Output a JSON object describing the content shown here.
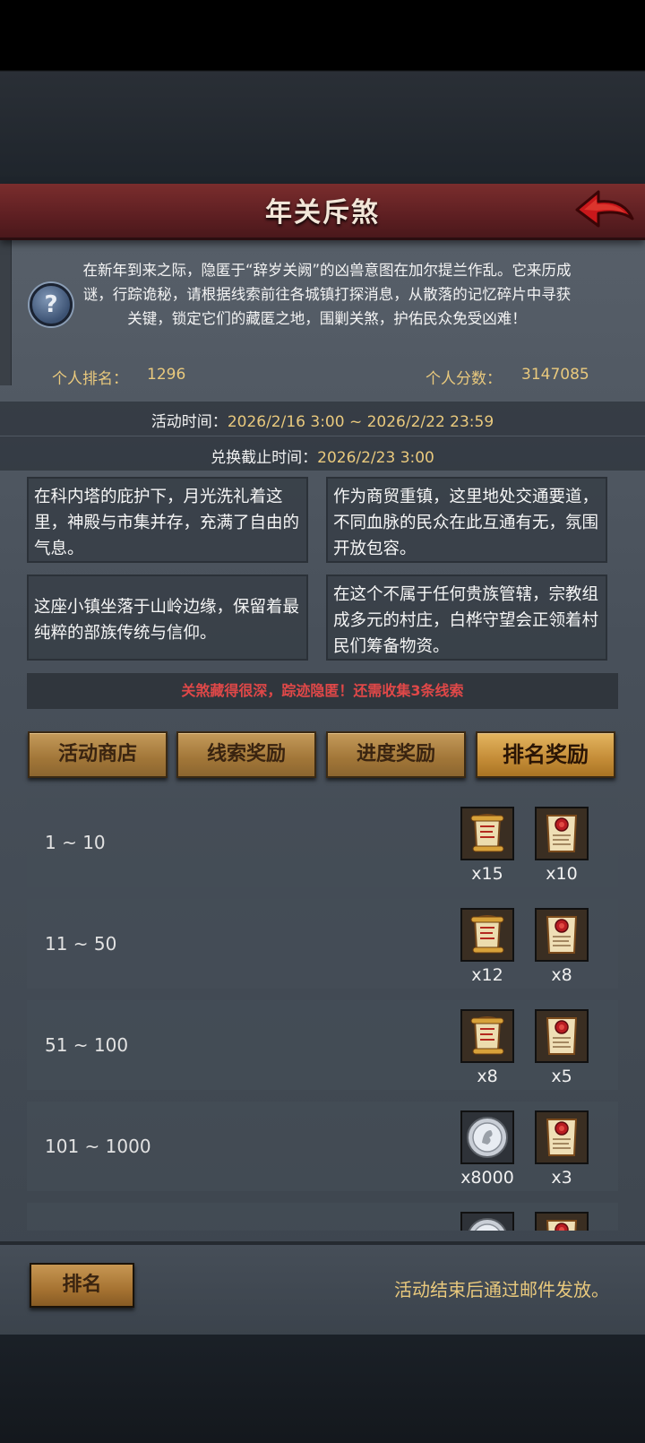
{
  "header": {
    "title": "年关斥煞"
  },
  "intro": "在新年到来之际，隐匿于“辞岁关阙”的凶兽意图在加尔提兰作乱。它来历成谜，行踪诡秘，请根据线索前往各城镇打探消息，从散落的记忆碎片中寻获关键，锁定它们的藏匿之地，围剿关煞，护佑民众免受凶难！",
  "stats": {
    "rank_label": "个人排名：",
    "rank_value": "1296",
    "score_label": "个人分数：",
    "score_value": "3147085"
  },
  "event_time": {
    "label": "活动时间：",
    "value": "2026/2/16 3:00 ~ 2026/2/22 23:59"
  },
  "exchange_deadline": {
    "label": "兑换截止时间：",
    "value": "2026/2/23 3:00"
  },
  "clues": [
    "在科内塔的庇护下，月光洗礼着这里，神殿与市集并存，充满了自由的气息。",
    "作为商贸重镇，这里地处交通要道，不同血脉的民众在此互通有无，氛围开放包容。",
    "这座小镇坐落于山岭边缘，保留着最纯粹的部族传统与信仰。",
    "在这个不属于任何贵族管辖，宗教组成多元的村庄，白桦守望会正领着村民们筹备物资。"
  ],
  "alert": "关煞藏得很深，踪迹隐匿！还需收集3条线索",
  "tabs": [
    {
      "label": "活动商店",
      "active": false
    },
    {
      "label": "线索奖励",
      "active": false
    },
    {
      "label": "进度奖励",
      "active": false
    },
    {
      "label": "排名奖励",
      "active": true
    }
  ],
  "rewards": [
    {
      "range": "1 ~ 10",
      "items": [
        {
          "icon": "scroll-gold-icon",
          "count": "x15"
        },
        {
          "icon": "scroll-seal-icon",
          "count": "x10"
        }
      ]
    },
    {
      "range": "11 ~ 50",
      "items": [
        {
          "icon": "scroll-gold-icon",
          "count": "x12"
        },
        {
          "icon": "scroll-seal-icon",
          "count": "x8"
        }
      ]
    },
    {
      "range": "51 ~ 100",
      "items": [
        {
          "icon": "scroll-gold-icon",
          "count": "x8"
        },
        {
          "icon": "scroll-seal-icon",
          "count": "x5"
        }
      ]
    },
    {
      "range": "101 ~ 1000",
      "items": [
        {
          "icon": "silver-coin-icon",
          "count": "x8000"
        },
        {
          "icon": "scroll-seal-icon",
          "count": "x3"
        }
      ]
    },
    {
      "range": "",
      "items": [
        {
          "icon": "silver-coin-icon",
          "count": ""
        },
        {
          "icon": "scroll-seal-icon",
          "count": ""
        }
      ]
    }
  ],
  "footer": {
    "rank_button": "排名",
    "note": "活动结束后通过邮件发放。"
  }
}
